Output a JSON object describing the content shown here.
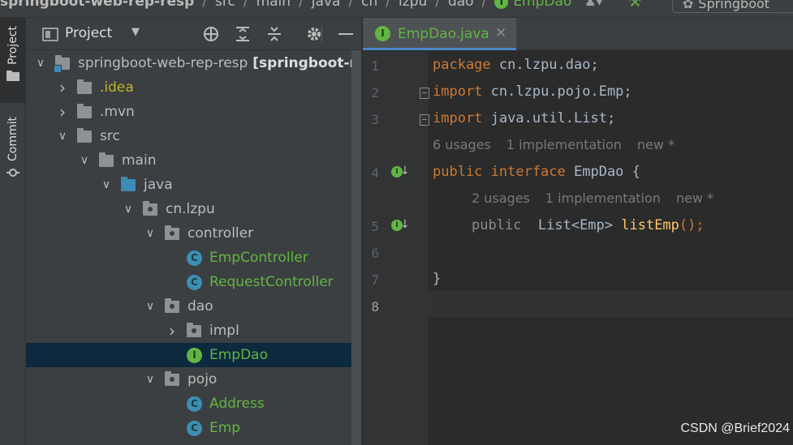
{
  "breadcrumb": {
    "items": [
      "springboot-web-rep-resp",
      "src",
      "main",
      "java",
      "cn",
      "lzpu",
      "dao"
    ],
    "current": "EmpDao",
    "run_config": "Springboot"
  },
  "toolstrip": {
    "project_label": "Project",
    "commit_label": "Commit"
  },
  "project_panel": {
    "title": "Project",
    "tree": [
      {
        "label": "springboot-web-rep-resp",
        "suffix": "[springboot-r",
        "depth": 0,
        "arrow": "open",
        "icon": "module-folder",
        "color": "default"
      },
      {
        "label": ".idea",
        "depth": 1,
        "arrow": "closed",
        "icon": "folder",
        "color": "yellow"
      },
      {
        "label": ".mvn",
        "depth": 1,
        "arrow": "closed",
        "icon": "folder",
        "color": "default"
      },
      {
        "label": "src",
        "depth": 1,
        "arrow": "open",
        "icon": "folder",
        "color": "default"
      },
      {
        "label": "main",
        "depth": 2,
        "arrow": "open",
        "icon": "folder",
        "color": "default"
      },
      {
        "label": "java",
        "depth": 3,
        "arrow": "open",
        "icon": "source-folder",
        "color": "default"
      },
      {
        "label": "cn.lzpu",
        "depth": 4,
        "arrow": "open",
        "icon": "package",
        "color": "default"
      },
      {
        "label": "controller",
        "depth": 5,
        "arrow": "open",
        "icon": "package",
        "color": "default"
      },
      {
        "label": "EmpController",
        "depth": 6,
        "arrow": "none",
        "icon": "class",
        "color": "green"
      },
      {
        "label": "RequestController",
        "depth": 6,
        "arrow": "none",
        "icon": "class",
        "color": "green"
      },
      {
        "label": "dao",
        "depth": 5,
        "arrow": "open",
        "icon": "package",
        "color": "default"
      },
      {
        "label": "impl",
        "depth": 6,
        "arrow": "closed",
        "icon": "package",
        "color": "default"
      },
      {
        "label": "EmpDao",
        "depth": 6,
        "arrow": "none",
        "icon": "interface",
        "color": "green",
        "selected": true
      },
      {
        "label": "pojo",
        "depth": 5,
        "arrow": "open",
        "icon": "package",
        "color": "default"
      },
      {
        "label": "Address",
        "depth": 6,
        "arrow": "none",
        "icon": "class",
        "color": "green"
      },
      {
        "label": "Emp",
        "depth": 6,
        "arrow": "none",
        "icon": "class",
        "color": "green"
      }
    ]
  },
  "editor": {
    "tab_label": "EmpDao.java",
    "line_numbers": [
      "1",
      "2",
      "3",
      "4",
      "5",
      "6",
      "7",
      "8"
    ],
    "code": {
      "l1_kw": "package",
      "l1_rest": " cn.lzpu.dao;",
      "l2_kw": "import",
      "l2_rest": " cn.lzpu.pojo.Emp;",
      "l3_kw": "import",
      "l3_rest": " java.util.List;",
      "l4_kw": "public interface",
      "l4_rest": " EmpDao {",
      "l5_kw": "public",
      "l5_type": "  List<Emp> ",
      "l5_fn": "listEmp",
      "l5_end": "();",
      "l7": "}"
    },
    "hints": {
      "h1_usages": "6 usages",
      "h1_impl": "1 implementation",
      "h1_new": "new *",
      "h2_usages": "2 usages",
      "h2_impl": "1 implementation",
      "h2_new": "new *"
    }
  },
  "watermark": "CSDN @Brief2024"
}
